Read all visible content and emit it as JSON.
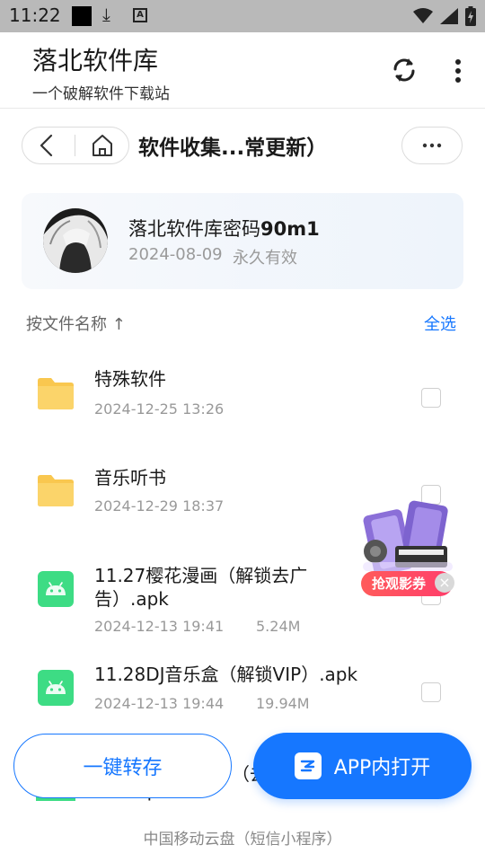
{
  "status_bar": {
    "time": "11:22"
  },
  "header": {
    "title": "落北软件库",
    "subtitle": "一个破解软件下载站"
  },
  "nav": {
    "folder_title": "软件收集...常更新）"
  },
  "share": {
    "name": "落北软件库密码",
    "name_bold": "90m1",
    "date": "2024-08-09",
    "validity": "永久有效"
  },
  "list_controls": {
    "sort_label": "按文件名称 ↑",
    "select_all": "全选"
  },
  "files": [
    {
      "name": "特殊软件",
      "date": "2024-12-25 13:26",
      "size": "",
      "type": "folder"
    },
    {
      "name": "音乐听书",
      "date": "2024-12-29 18:37",
      "size": "",
      "type": "folder"
    },
    {
      "name": "11.27樱花漫画（解锁去广告）.apk",
      "date": "2024-12-13 19:41",
      "size": "5.24M",
      "type": "apk"
    },
    {
      "name": "11.28DJ音乐盒（解锁VIP）.apk",
      "date": "2024-12-13 19:44",
      "size": "19.94M",
      "type": "apk"
    },
    {
      "name_line1": "（去",
      "name_line2": "能）.apk",
      "type": "apk"
    }
  ],
  "promo": {
    "label": "抢观影券",
    "close": "×"
  },
  "actions": {
    "save": "一键转存",
    "open_in_app": "APP内打开"
  },
  "footer": "中国移动云盘（短信小程序）",
  "colors": {
    "accent": "#1677ff",
    "folder": "#f9c74f",
    "apk": "#3ddc84"
  }
}
